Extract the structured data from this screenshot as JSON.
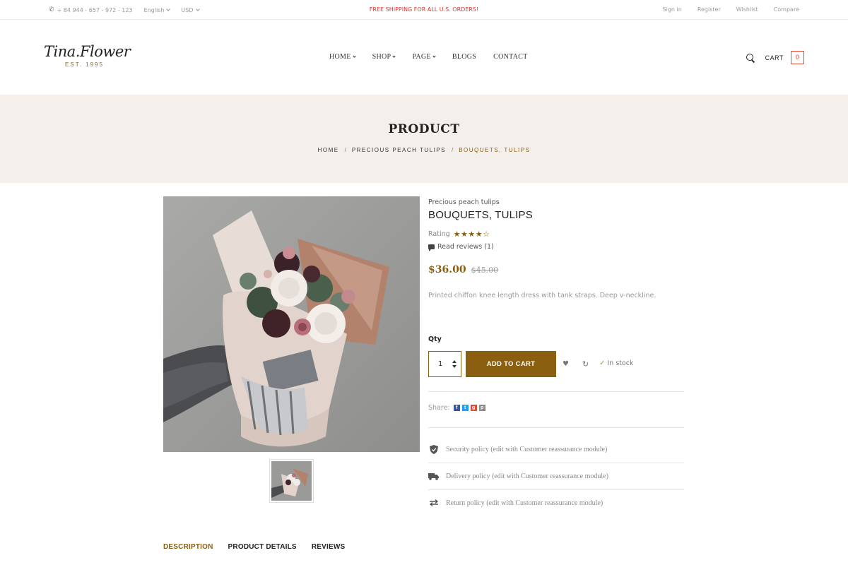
{
  "topbar": {
    "phone": "+ 84 944 - 657 - 972 - 123",
    "language": "English",
    "currency": "USD",
    "promo": "FREE SHIPPING FOR ALL U.S. ORDERS!",
    "links": [
      "Sign in",
      "Register",
      "Wishlist",
      "Compare"
    ]
  },
  "brand": {
    "name": "Tina.Flower",
    "est": "EST. 1995",
    "accent": "#8a5f0f"
  },
  "nav": {
    "items": [
      "HOME",
      "SHOP",
      "PAGE",
      "BLOGS",
      "CONTACT"
    ]
  },
  "header_icons": {
    "cart_label": "CART",
    "cart_count": "0"
  },
  "banner": {
    "title": "PRODUCT",
    "breadcrumb": [
      "HOME",
      "PRECIOUS PEACH TULIPS",
      "BOUQUETS, TULIPS"
    ]
  },
  "product": {
    "subtitle": "Precious peach tulips",
    "name": "BOUQUETS, TULIPS",
    "rating_label": "Rating",
    "rating_value": 4,
    "rating_max": 5,
    "reviews": "Read reviews (1)",
    "price": "$36.00",
    "old_price": "$45.00",
    "description": "Printed chiffon knee length dress with tank straps. Deep v-neckline.",
    "qty_label": "Qty",
    "qty_value": "1",
    "add_to_cart": "ADD TO CART",
    "stock": "In stock",
    "share_label": "Share:",
    "share_icons": [
      "facebook-icon",
      "twitter-icon",
      "google-plus-icon",
      "pinterest-icon"
    ]
  },
  "policies": [
    "Security policy (edit with Customer reassurance module)",
    "Delivery policy (edit with Customer reassurance module)",
    "Return policy (edit with Customer reassurance module)"
  ],
  "tabs": [
    "DESCRIPTION",
    "PRODUCT DETAILS",
    "REVIEWS"
  ]
}
